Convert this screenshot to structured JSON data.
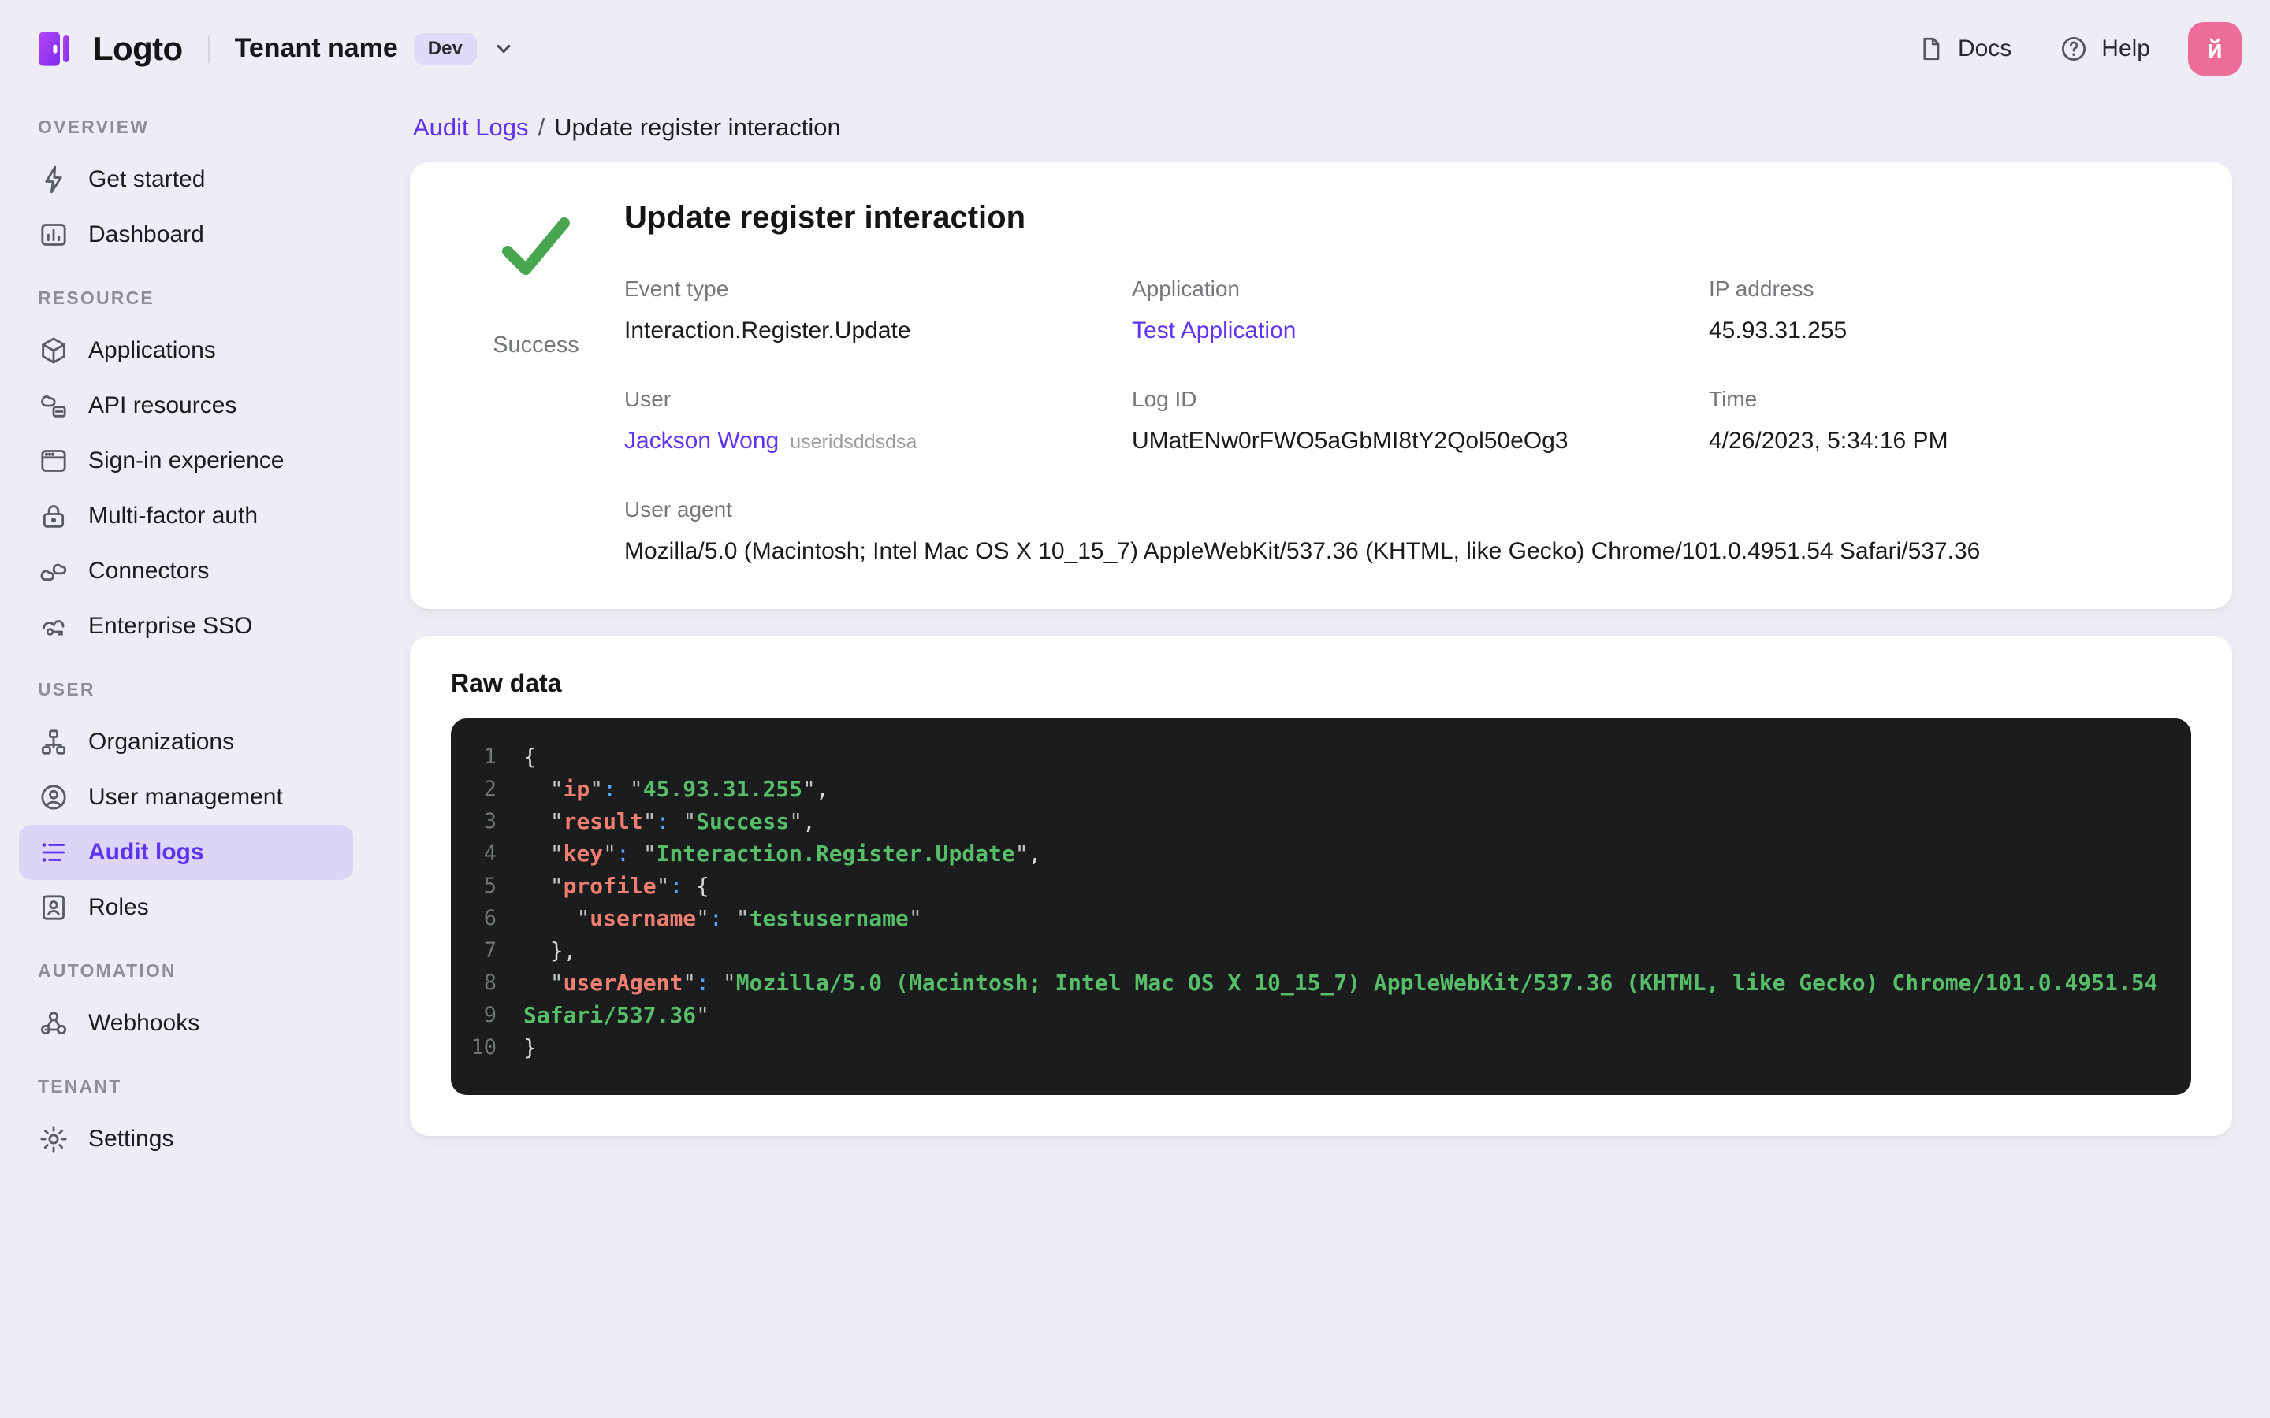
{
  "topbar": {
    "logo_text": "Logto",
    "tenant_name": "Tenant name",
    "tenant_tag": "Dev",
    "docs_label": "Docs",
    "help_label": "Help",
    "avatar_letter": "й"
  },
  "sidebar": {
    "sections": [
      {
        "header": "OVERVIEW",
        "items": [
          {
            "label": "Get started",
            "icon": "zap-icon",
            "active": false
          },
          {
            "label": "Dashboard",
            "icon": "dashboard-icon",
            "active": false
          }
        ]
      },
      {
        "header": "RESOURCE",
        "items": [
          {
            "label": "Applications",
            "icon": "box-icon",
            "active": false
          },
          {
            "label": "API resources",
            "icon": "cloud-box-icon",
            "active": false
          },
          {
            "label": "Sign-in experience",
            "icon": "browser-icon",
            "active": false
          },
          {
            "label": "Multi-factor auth",
            "icon": "lock-icon",
            "active": false
          },
          {
            "label": "Connectors",
            "icon": "connectors-icon",
            "active": false
          },
          {
            "label": "Enterprise SSO",
            "icon": "cloud-key-icon",
            "active": false
          }
        ]
      },
      {
        "header": "USER",
        "items": [
          {
            "label": "Organizations",
            "icon": "org-chart-icon",
            "active": false
          },
          {
            "label": "User management",
            "icon": "user-circle-icon",
            "active": false
          },
          {
            "label": "Audit logs",
            "icon": "list-icon",
            "active": true
          },
          {
            "label": "Roles",
            "icon": "badge-person-icon",
            "active": false
          }
        ]
      },
      {
        "header": "AUTOMATION",
        "items": [
          {
            "label": "Webhooks",
            "icon": "webhook-icon",
            "active": false
          }
        ]
      },
      {
        "header": "TENANT",
        "items": [
          {
            "label": "Settings",
            "icon": "gear-icon",
            "active": false
          }
        ]
      }
    ]
  },
  "breadcrumb": {
    "parent": "Audit Logs",
    "separator": "/",
    "current": "Update register interaction"
  },
  "detail": {
    "status": "Success",
    "status_color": "#47a64f",
    "title": "Update register interaction",
    "fields": {
      "event_type": {
        "label": "Event type",
        "value": "Interaction.Register.Update"
      },
      "application": {
        "label": "Application",
        "value": "Test Application"
      },
      "ip_address": {
        "label": "IP address",
        "value": "45.93.31.255"
      },
      "user": {
        "label": "User",
        "value": "Jackson Wong",
        "suffix": "useridsddsdsa"
      },
      "log_id": {
        "label": "Log ID",
        "value": "UMatENw0rFWO5aGbMI8tY2Qol50eOg3"
      },
      "time": {
        "label": "Time",
        "value": "4/26/2023, 5:34:16 PM"
      },
      "user_agent": {
        "label": "User agent",
        "value": "Mozilla/5.0 (Macintosh; Intel Mac OS X 10_15_7) AppleWebKit/537.36 (KHTML, like Gecko) Chrome/101.0.4951.54 Safari/537.36"
      }
    }
  },
  "raw_data": {
    "title": "Raw data",
    "syntax_colors": {
      "pln": "#d5d9da",
      "q": "#bcc2c4",
      "key": "#f07e71",
      "col": "#58a6ff",
      "str": "#57bd68",
      "line_number": "#6f7476",
      "background": "#1a1c1d"
    },
    "lines": [
      {
        "num": "1",
        "tokens": [
          [
            "pln",
            "{"
          ]
        ]
      },
      {
        "num": "2",
        "tokens": [
          [
            "pln",
            "  "
          ],
          [
            "q",
            "\""
          ],
          [
            "key",
            "ip"
          ],
          [
            "q",
            "\""
          ],
          [
            "col",
            ":"
          ],
          [
            "pln",
            " "
          ],
          [
            "q",
            "\""
          ],
          [
            "str",
            "45.93.31.255"
          ],
          [
            "q",
            "\""
          ],
          [
            "pln",
            ","
          ]
        ]
      },
      {
        "num": "3",
        "tokens": [
          [
            "pln",
            "  "
          ],
          [
            "q",
            "\""
          ],
          [
            "key",
            "result"
          ],
          [
            "q",
            "\""
          ],
          [
            "col",
            ":"
          ],
          [
            "pln",
            " "
          ],
          [
            "q",
            "\""
          ],
          [
            "str",
            "Success"
          ],
          [
            "q",
            "\""
          ],
          [
            "pln",
            ","
          ]
        ]
      },
      {
        "num": "4",
        "tokens": [
          [
            "pln",
            "  "
          ],
          [
            "q",
            "\""
          ],
          [
            "key",
            "key"
          ],
          [
            "q",
            "\""
          ],
          [
            "col",
            ":"
          ],
          [
            "pln",
            " "
          ],
          [
            "q",
            "\""
          ],
          [
            "str",
            "Interaction.Register.Update"
          ],
          [
            "q",
            "\""
          ],
          [
            "pln",
            ","
          ]
        ]
      },
      {
        "num": "5",
        "tokens": [
          [
            "pln",
            "  "
          ],
          [
            "q",
            "\""
          ],
          [
            "key",
            "profile"
          ],
          [
            "q",
            "\""
          ],
          [
            "col",
            ":"
          ],
          [
            "pln",
            " {"
          ]
        ]
      },
      {
        "num": "6",
        "tokens": [
          [
            "pln",
            "    "
          ],
          [
            "q",
            "\""
          ],
          [
            "key",
            "username"
          ],
          [
            "q",
            "\""
          ],
          [
            "col",
            ":"
          ],
          [
            "pln",
            " "
          ],
          [
            "q",
            "\""
          ],
          [
            "str",
            "testusername"
          ],
          [
            "q",
            "\""
          ]
        ]
      },
      {
        "num": "7",
        "tokens": [
          [
            "pln",
            "  },"
          ]
        ]
      },
      {
        "num": "8",
        "tokens": [
          [
            "pln",
            "  "
          ],
          [
            "q",
            "\""
          ],
          [
            "key",
            "userAgent"
          ],
          [
            "q",
            "\""
          ],
          [
            "col",
            ":"
          ],
          [
            "pln",
            " "
          ],
          [
            "q",
            "\""
          ],
          [
            "str",
            "Mozilla/5.0 (Macintosh; Intel Mac OS X 10_15_7) AppleWebKit/537.36 (KHTML, like Gecko) Chrome/101.0.4951.54"
          ]
        ]
      },
      {
        "num": "9",
        "tokens": [
          [
            "str",
            "Safari/537.36"
          ],
          [
            "q",
            "\""
          ]
        ]
      },
      {
        "num": "10",
        "tokens": [
          [
            "pln",
            "}"
          ]
        ]
      }
    ]
  }
}
